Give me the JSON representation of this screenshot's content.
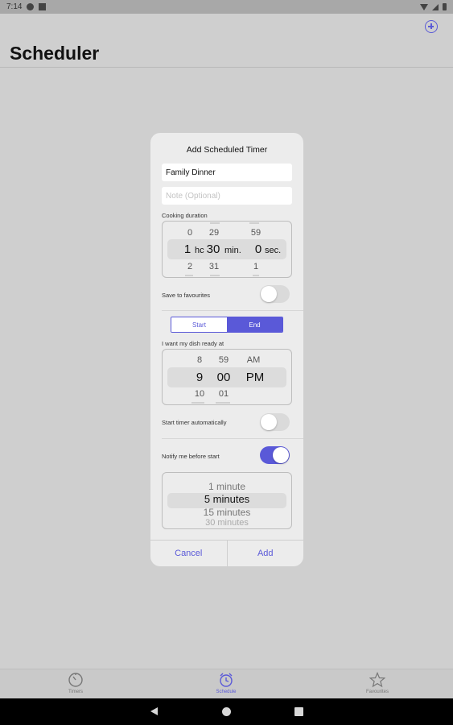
{
  "status_bar": {
    "time": "7:14"
  },
  "header": {
    "title": "Scheduler",
    "add_icon": "plus-circle-icon"
  },
  "dialog": {
    "title": "Add Scheduled Timer",
    "name_value": "Family Dinner",
    "note_placeholder": "Note (Optional)",
    "duration": {
      "label": "Cooking duration",
      "hours_above": "0",
      "hours": "1",
      "hours_below": "2",
      "hours_unit": "hc",
      "minutes_above": "29",
      "minutes": "30",
      "minutes_below": "31",
      "minutes_unit": "min.",
      "seconds_above": "59",
      "seconds": "0",
      "seconds_below": "1",
      "seconds_unit": "sec."
    },
    "favourites": {
      "label": "Save to favourites",
      "on": false
    },
    "mode": {
      "start_label": "Start",
      "end_label": "End",
      "selected": "End"
    },
    "ready_at": {
      "label": "I want my dish ready at",
      "hour_above": "8",
      "hour": "9",
      "hour_below": "10",
      "minute_above": "59",
      "minute": "00",
      "minute_below": "01",
      "ampm_above": "AM",
      "ampm": "PM"
    },
    "auto_start": {
      "label": "Start timer automatically",
      "on": false
    },
    "notify": {
      "label": "Notify me before start",
      "on": true
    },
    "notify_options": {
      "above": "1 minute",
      "selected": "5 minutes",
      "below": "15 minutes",
      "below2": "30 minutes"
    },
    "cancel_label": "Cancel",
    "add_label": "Add"
  },
  "tabs": [
    {
      "label": "Timers",
      "icon": "timer-icon",
      "active": false
    },
    {
      "label": "Schedule",
      "icon": "alarm-clock-icon",
      "active": true
    },
    {
      "label": "Favourites",
      "icon": "star-icon",
      "active": false
    }
  ],
  "colors": {
    "accent": "#5a59d8",
    "background": "#cfcfcf",
    "dialog": "#ececec"
  }
}
